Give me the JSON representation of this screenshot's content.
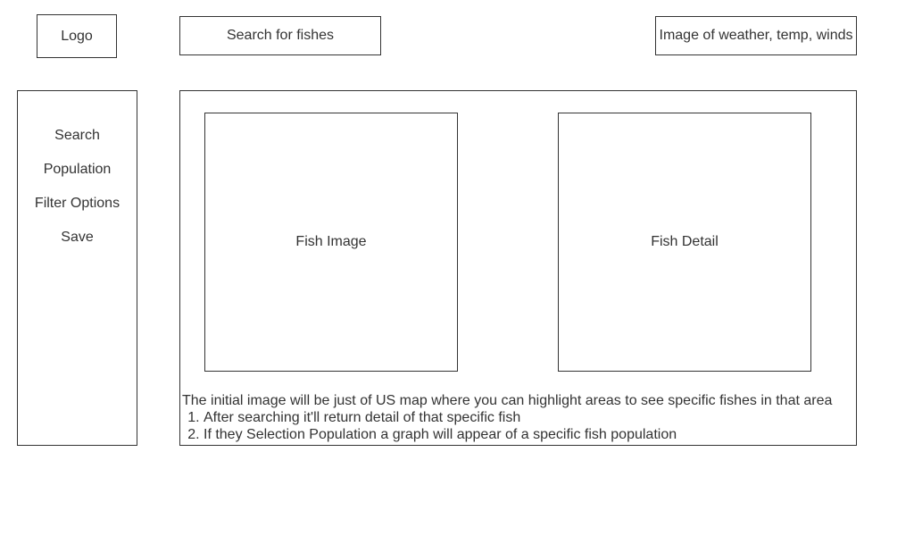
{
  "header": {
    "logo_label": "Logo",
    "search_label": "Search for fishes",
    "weather_label": "Image of weather, temp, winds"
  },
  "sidebar": {
    "items": [
      {
        "label": "Search"
      },
      {
        "label": "Population"
      },
      {
        "label": "Filter Options"
      },
      {
        "label": "Save"
      }
    ]
  },
  "main": {
    "fish_image_label": "Fish Image",
    "fish_detail_label": "Fish Detail",
    "notes": {
      "intro": "The initial image will be just of US map where you can highlight areas to see specific fishes in that area",
      "items": [
        "After searching it'll return detail of that specific fish",
        "If they Selection Population a graph will appear of a specific fish population"
      ]
    }
  }
}
